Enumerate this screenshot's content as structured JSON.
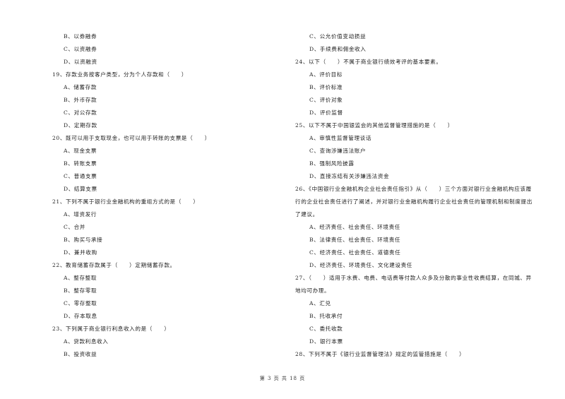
{
  "left_column": {
    "lead_options": [
      {
        "label": "B、以券融券"
      },
      {
        "label": "C、以资融券"
      },
      {
        "label": "D、以资融资"
      }
    ],
    "questions": [
      {
        "text": "19、存款业务按客户类型，分为个人存款和（　　）",
        "options": [
          "A、储蓄存款",
          "B、外币存款",
          "C、对公存款",
          "D、定期存款"
        ]
      },
      {
        "text": "20、既可以用于支取现金，也可以用于转账的支票是（　　）",
        "options": [
          "A、现金支票",
          "B、转账支票",
          "C、普通支票",
          "D、结算支票"
        ]
      },
      {
        "text": "21、下列不属于银行业金融机构的重组方式的是（　　）",
        "options": [
          "A、增资发行",
          "C、合并",
          "B、购买与承接",
          "D、兼并收购"
        ]
      },
      {
        "text": "22、教育储蓄存款属于（　　）定期储蓄存款。",
        "options": [
          "A、整存整取",
          "B、整存零取",
          "C、零存整取",
          "D、存本取息"
        ]
      },
      {
        "text": "23、下列属于商业银行利息收入的是（　　）",
        "options": [
          "A、贷款利息收入",
          "B、投资收益"
        ]
      }
    ]
  },
  "right_column": {
    "lead_options": [
      {
        "label": "C、公允价值变动损益"
      },
      {
        "label": "D、手续费和佣金收入"
      }
    ],
    "questions": [
      {
        "text": "24、以下（　　）不属于商业银行绩效考评的基本要素。",
        "options": [
          "A、评价目标",
          "B、评价标准",
          "C、评价对象",
          "D、评价监督"
        ]
      },
      {
        "text": "25、以下不属于中国银监会的其他监督管理措施的是（　　）",
        "options": [
          "A、审慎性监督管理谈话",
          "C、查询涉嫌违法账户",
          "B、强制风险披露",
          "D、直接冻结有关涉嫌违法资金"
        ]
      },
      {
        "text_lines": [
          "26、《中国银行业金融机构企业社会责任指引》从（　　）三个方面对银行业金融机构应该履",
          "行的企业社会责任进行了阐述，并对银行业金融机构履行企业社会责任的管理机制和制度提出",
          "了建议。"
        ],
        "options": [
          "A、经济责任、社会责任、环境责任",
          "B、法律责任、社会责任、环境责任",
          "C、经济责任、社会责任、道德责任",
          "D、经济责任、环境责任、文化建设责任"
        ]
      },
      {
        "text_lines": [
          "27、（　　）适用于水费、电费、电话费等付款人众多及分散的事业性收费结算，在同城、异",
          "地均可办理。"
        ],
        "options": [
          "A、汇兑",
          "B、托收承付",
          "C、委托收款",
          "D、银行本票"
        ]
      },
      {
        "text": "28、下列不属于《银行业监督管理法》规定的监管措施是（　　）",
        "options": []
      }
    ]
  },
  "footer": {
    "page_label": "第 3 页 共 18 页"
  }
}
